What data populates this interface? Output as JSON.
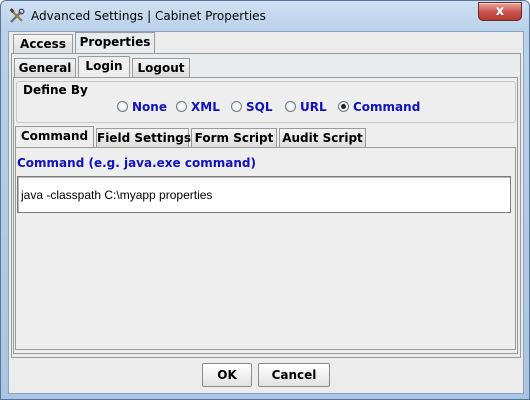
{
  "window": {
    "title": "Advanced Settings | Cabinet Properties",
    "close_glyph": "x"
  },
  "top_tabs": [
    {
      "label": "Access",
      "selected": false
    },
    {
      "label": "Properties",
      "selected": true
    }
  ],
  "properties_tabs": [
    {
      "label": "General",
      "selected": false
    },
    {
      "label": "Login",
      "selected": true
    },
    {
      "label": "Logout",
      "selected": false
    }
  ],
  "define_by": {
    "label": "Define By",
    "options": [
      {
        "label": "None",
        "checked": false
      },
      {
        "label": "XML",
        "checked": false
      },
      {
        "label": "SQL",
        "checked": false
      },
      {
        "label": "URL",
        "checked": false
      },
      {
        "label": "Command",
        "checked": true
      }
    ]
  },
  "command_tabs": [
    {
      "label": "Command",
      "selected": true
    },
    {
      "label": "Field Settings",
      "selected": false
    },
    {
      "label": "Form Script",
      "selected": false
    },
    {
      "label": "Audit Script",
      "selected": false
    }
  ],
  "command_panel": {
    "heading": "Command (e.g. java.exe command)",
    "value": "java -classpath C:\\myapp properties"
  },
  "buttons": {
    "ok": "OK",
    "cancel": "Cancel"
  },
  "colors": {
    "accent_label": "#1010c0",
    "title_gradient_top": "#cfe0f3",
    "close_button": "#c75050"
  }
}
